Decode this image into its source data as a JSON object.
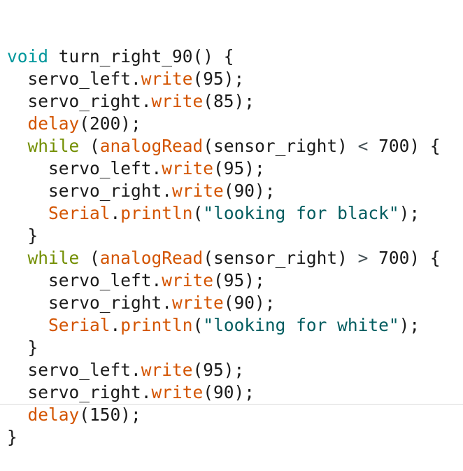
{
  "colors": {
    "background": "#ffffff",
    "plain": "#1a1a1a",
    "type": "#00979c",
    "control": "#728e00",
    "function": "#d35400",
    "string": "#005c5f",
    "operator": "#434f54"
  },
  "code": {
    "lines": [
      [
        {
          "k": "type",
          "t": "void"
        },
        {
          "k": "plain",
          "t": " turn_right_90() {"
        }
      ],
      [
        {
          "k": "plain",
          "t": "  servo_left."
        },
        {
          "k": "fn",
          "t": "write"
        },
        {
          "k": "plain",
          "t": "(95);"
        }
      ],
      [
        {
          "k": "plain",
          "t": "  servo_right."
        },
        {
          "k": "fn",
          "t": "write"
        },
        {
          "k": "plain",
          "t": "(85);"
        }
      ],
      [
        {
          "k": "plain",
          "t": "  "
        },
        {
          "k": "fn",
          "t": "delay"
        },
        {
          "k": "plain",
          "t": "(200);"
        }
      ],
      [
        {
          "k": "plain",
          "t": "  "
        },
        {
          "k": "ctrl",
          "t": "while"
        },
        {
          "k": "plain",
          "t": " ("
        },
        {
          "k": "fn",
          "t": "analogRead"
        },
        {
          "k": "plain",
          "t": "(sensor_right) "
        },
        {
          "k": "op",
          "t": "<"
        },
        {
          "k": "plain",
          "t": " 700) {"
        }
      ],
      [
        {
          "k": "plain",
          "t": "    servo_left."
        },
        {
          "k": "fn",
          "t": "write"
        },
        {
          "k": "plain",
          "t": "(95);"
        }
      ],
      [
        {
          "k": "plain",
          "t": "    servo_right."
        },
        {
          "k": "fn",
          "t": "write"
        },
        {
          "k": "plain",
          "t": "(90);"
        }
      ],
      [
        {
          "k": "plain",
          "t": "    "
        },
        {
          "k": "fn",
          "t": "Serial"
        },
        {
          "k": "plain",
          "t": "."
        },
        {
          "k": "fn",
          "t": "println"
        },
        {
          "k": "plain",
          "t": "("
        },
        {
          "k": "str",
          "t": "\"looking for black\""
        },
        {
          "k": "plain",
          "t": ");"
        }
      ],
      [
        {
          "k": "plain",
          "t": "  }"
        }
      ],
      [
        {
          "k": "plain",
          "t": "  "
        },
        {
          "k": "ctrl",
          "t": "while"
        },
        {
          "k": "plain",
          "t": " ("
        },
        {
          "k": "fn",
          "t": "analogRead"
        },
        {
          "k": "plain",
          "t": "(sensor_right) "
        },
        {
          "k": "op",
          "t": ">"
        },
        {
          "k": "plain",
          "t": " 700) {"
        }
      ],
      [
        {
          "k": "plain",
          "t": "    servo_left."
        },
        {
          "k": "fn",
          "t": "write"
        },
        {
          "k": "plain",
          "t": "(95);"
        }
      ],
      [
        {
          "k": "plain",
          "t": "    servo_right."
        },
        {
          "k": "fn",
          "t": "write"
        },
        {
          "k": "plain",
          "t": "(90);"
        }
      ],
      [
        {
          "k": "plain",
          "t": "    "
        },
        {
          "k": "fn",
          "t": "Serial"
        },
        {
          "k": "plain",
          "t": "."
        },
        {
          "k": "fn",
          "t": "println"
        },
        {
          "k": "plain",
          "t": "("
        },
        {
          "k": "str",
          "t": "\"looking for white\""
        },
        {
          "k": "plain",
          "t": ");"
        }
      ],
      [
        {
          "k": "plain",
          "t": "  }"
        }
      ],
      [
        {
          "k": "plain",
          "t": "  servo_left."
        },
        {
          "k": "fn",
          "t": "write"
        },
        {
          "k": "plain",
          "t": "(95);"
        }
      ],
      [
        {
          "k": "plain",
          "t": "  servo_right."
        },
        {
          "k": "fn",
          "t": "write"
        },
        {
          "k": "plain",
          "t": "(90);"
        }
      ],
      [
        {
          "k": "plain",
          "t": "  "
        },
        {
          "k": "fn",
          "t": "delay"
        },
        {
          "k": "plain",
          "t": "(150);"
        }
      ],
      [
        {
          "k": "plain",
          "t": "}"
        }
      ]
    ]
  }
}
